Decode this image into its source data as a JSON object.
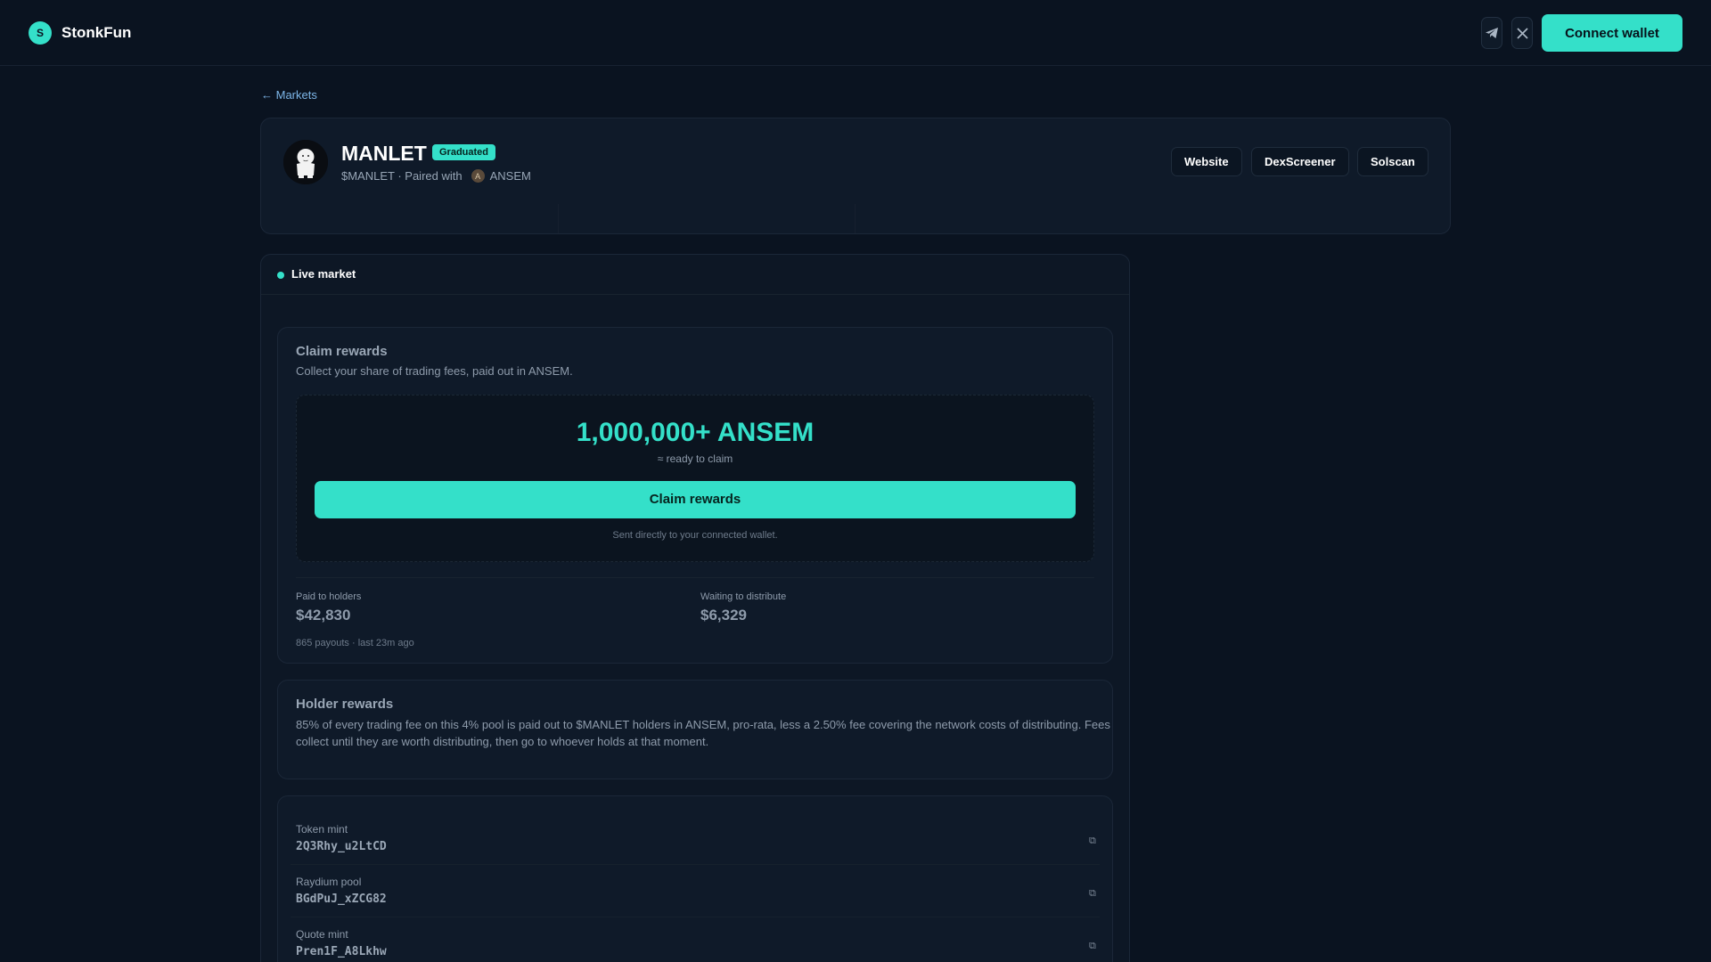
{
  "header": {
    "brand_letter": "S",
    "brand_name": "StonkFun",
    "connect_label": "Connect wallet",
    "icons": [
      "telegram-icon",
      "x-icon"
    ]
  },
  "nav": {
    "back_label": "← Markets"
  },
  "token": {
    "name": "MANLET",
    "status_badge": "Graduated",
    "ticker_pair": "$MANLET · Paired with",
    "pair_letter": "A",
    "pair_token": "ANSEM",
    "links": [
      "Website",
      "DexScreener",
      "Solscan"
    ]
  },
  "live_market": {
    "title": "Live market",
    "claim": {
      "title": "Claim rewards",
      "description": "Collect your share of trading fees, paid out in ANSEM.",
      "amount": "1,000,000+ ANSEM",
      "amount_caption": "≈ ready to claim",
      "button_label": "Claim rewards",
      "note": "Sent directly to your connected wallet.",
      "paid_label": "Paid to holders",
      "paid_value": "$42,830",
      "waiting_label": "Waiting to distribute",
      "waiting_value": "$6,329",
      "payout_note": "865 payouts · last 23m ago"
    },
    "holder": {
      "title": "Holder rewards",
      "description_line1": "85% of every trading fee on this 4% pool is paid out to $MANLET holders in ANSEM, pro-rata, less a 2.50% fee covering the network costs of distributing. Fees",
      "description_line2": "collect until they are worth distributing, then go to whoever holds at that moment."
    },
    "addresses": [
      {
        "label": "Token mint",
        "value": "2Q3Rhy_u2LtCD"
      },
      {
        "label": "Raydium pool",
        "value": "BGdPuJ_xZCG82"
      },
      {
        "label": "Quote mint",
        "value": "Pren1F_A8Lkhw"
      }
    ],
    "copy_glyph": "⧉"
  },
  "colors": {
    "accent": "#34e0c9",
    "background": "#0a1320",
    "card": "#0f1a29"
  }
}
